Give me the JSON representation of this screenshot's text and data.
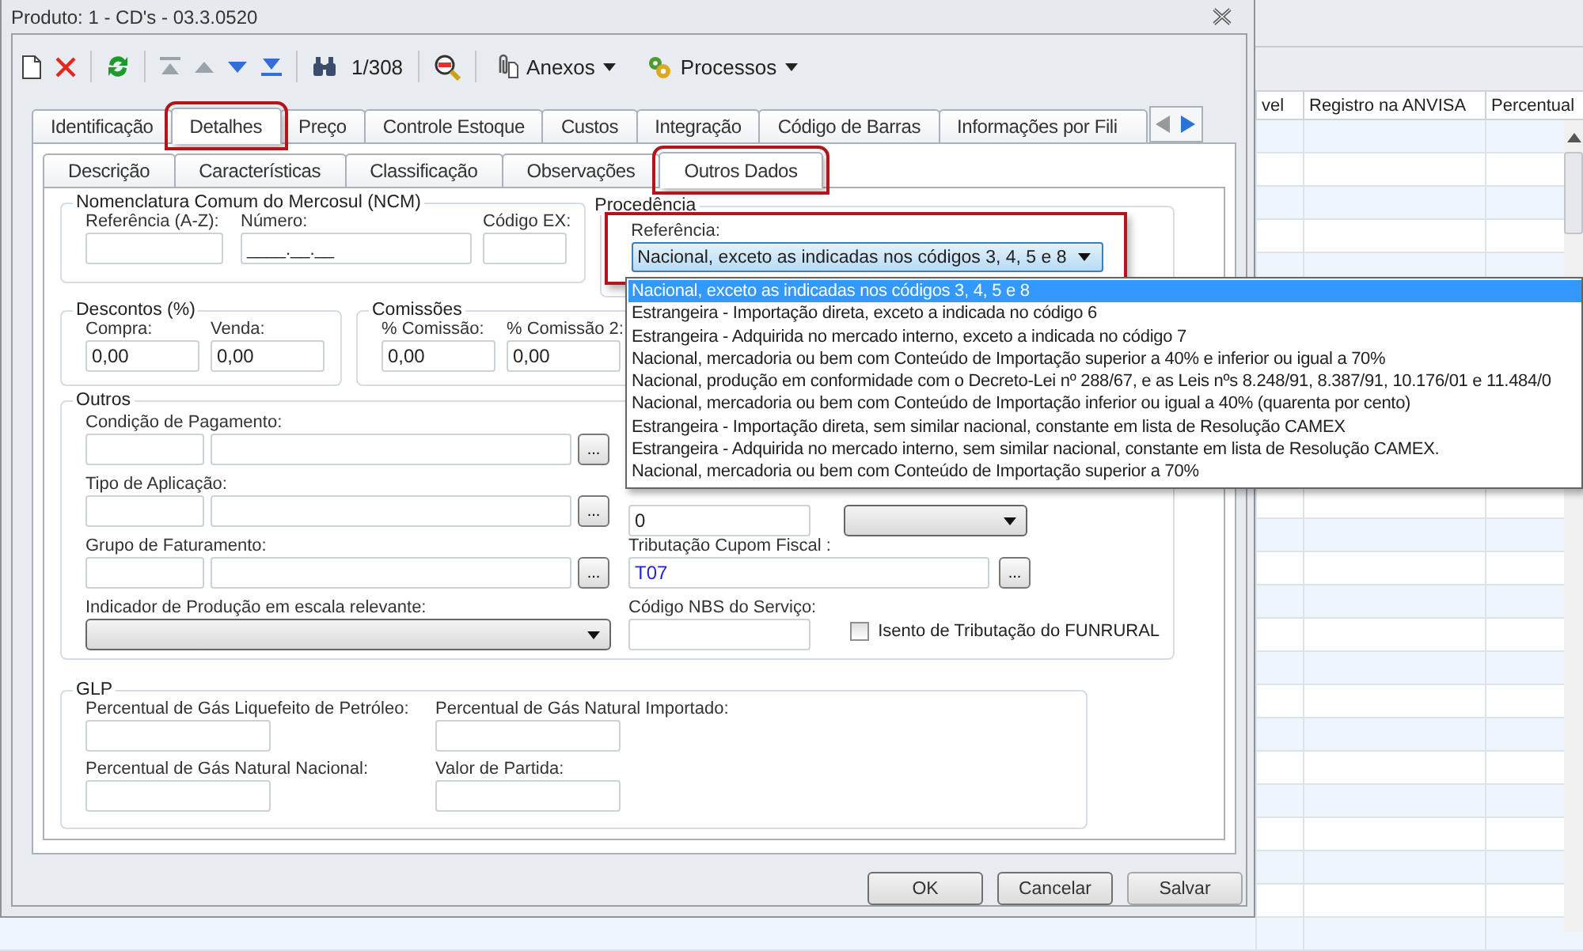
{
  "window": {
    "title": "Produto: 1 - CD's - 03.3.0520"
  },
  "toolbar": {
    "record_counter": "1/308",
    "menus": [
      {
        "label": "Anexos"
      },
      {
        "label": "Processos"
      }
    ]
  },
  "tabs": [
    {
      "label": "Identificação",
      "selected": false,
      "highlighted": false
    },
    {
      "label": "Detalhes",
      "selected": true,
      "highlighted": true
    },
    {
      "label": "Preço",
      "selected": false,
      "highlighted": false
    },
    {
      "label": "Controle Estoque",
      "selected": false,
      "highlighted": false
    },
    {
      "label": "Custos",
      "selected": false,
      "highlighted": false
    },
    {
      "label": "Integração",
      "selected": false,
      "highlighted": false
    },
    {
      "label": "Código de Barras",
      "selected": false,
      "highlighted": false
    },
    {
      "label": "Informações por Fili",
      "selected": false,
      "highlighted": false
    }
  ],
  "subtabs": [
    {
      "label": "Descrição",
      "selected": false,
      "highlighted": false
    },
    {
      "label": "Características",
      "selected": false,
      "highlighted": false
    },
    {
      "label": "Classificação",
      "selected": false,
      "highlighted": false
    },
    {
      "label": "Observações",
      "selected": false,
      "highlighted": false
    },
    {
      "label": "Outros Dados",
      "selected": true,
      "highlighted": true
    }
  ],
  "ncm": {
    "title": "Nomenclatura Comum do Mercosul (NCM)",
    "fields": [
      {
        "label": "Referência (A-Z):"
      },
      {
        "label": "Número:",
        "value": "____.__.__"
      },
      {
        "label": "Código EX:"
      }
    ]
  },
  "procedencia": {
    "title": "Procedência",
    "label": "Referência:",
    "value": "Nacional, exceto as indicadas nos códigos 3, 4, 5 e 8",
    "highlighted": true,
    "expanded": true,
    "options": [
      {
        "text": "Nacional, exceto as indicadas nos códigos 3, 4, 5 e 8",
        "selected": true
      },
      {
        "text": "Estrangeira - Importação direta, exceto a indicada no código 6",
        "selected": false
      },
      {
        "text": "Estrangeira - Adquirida no mercado interno, exceto a indicada no código 7",
        "selected": false
      },
      {
        "text": "Nacional, mercadoria ou bem com Conteúdo de Importação superior a 40% e inferior ou igual a 70%",
        "selected": false
      },
      {
        "text": "Nacional, produção em conformidade com o Decreto-Lei nº 288/67, e as Leis nºs 8.248/91, 8.387/91, 10.176/01 e 11.484/0",
        "selected": false
      },
      {
        "text": "Nacional, mercadoria ou bem com Conteúdo de Importação inferior ou igual a 40% (quarenta por cento)",
        "selected": false
      },
      {
        "text": "Estrangeira - Importação direta, sem similar nacional, constante em lista de Resolução CAMEX",
        "selected": false
      },
      {
        "text": "Estrangeira - Adquirida no mercado interno, sem similar nacional, constante em lista de Resolução CAMEX.",
        "selected": false
      },
      {
        "text": "Nacional, mercadoria ou bem com Conteúdo de Importação superior a 70%",
        "selected": false
      }
    ]
  },
  "descontos": {
    "title": "Descontos (%)",
    "fields": [
      {
        "label": "Compra:",
        "value": "0,00"
      },
      {
        "label": "Venda:",
        "value": "0,00"
      }
    ]
  },
  "comissoes": {
    "title": "Comissões",
    "fields": [
      {
        "label": "% Comissão:",
        "value": "0,00"
      },
      {
        "label": "% Comissão 2:",
        "value": "0,00"
      }
    ]
  },
  "outros": {
    "title": "Outros",
    "lookups": [
      {
        "label": "Condição de Pagamento:",
        "button": "..."
      },
      {
        "label": "Tipo de Aplicação:",
        "button": "..."
      },
      {
        "label": "Grupo de Faturamento:",
        "button": "..."
      }
    ],
    "indicador": {
      "label": "Indicador de Produção em escala relevante:"
    },
    "margem": {
      "value": "0"
    },
    "cupom": {
      "label": "Tributação Cupom Fiscal :",
      "value": "T07",
      "button": "..."
    },
    "nbs": {
      "label": "Código NBS do Serviço:"
    },
    "funrural": {
      "label": "Isento de Tributação do FUNRURAL",
      "checked": false
    }
  },
  "glp": {
    "title": "GLP",
    "fields": [
      {
        "label": "Percentual de Gás Liquefeito de Petróleo:"
      },
      {
        "label": "Percentual de Gás Natural Importado:"
      },
      {
        "label": "Percentual de Gás Natural Nacional:"
      },
      {
        "label": "Valor de Partida:"
      }
    ]
  },
  "buttons": [
    "OK",
    "Cancelar",
    "Salvar"
  ],
  "background_table": {
    "columns": [
      "vel",
      "Registro na ANVISA",
      "Percentual"
    ]
  }
}
